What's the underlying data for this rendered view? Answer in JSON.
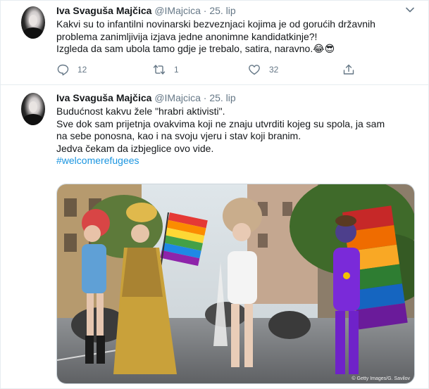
{
  "tweets": [
    {
      "name": "Iva Svaguša Majčica",
      "handle": "@IMajcica",
      "dot": "·",
      "date": "25. lip",
      "lines": [
        "Kakvi su to infantilni novinarski bezveznjaci kojima je od gorućih državnih",
        "problema zanimljivija izjava jedne anonimne kandidatkinje?!",
        "Izgleda da sam ubola tamo gdje je trebalo, satira, naravno.😂😎"
      ],
      "reply_count": "12",
      "retweet_count": "1",
      "like_count": "32"
    },
    {
      "name": "Iva Svaguša Majčica",
      "handle": "@IMajcica",
      "dot": "·",
      "date": "25. lip",
      "lines": [
        "Budućnost kakvu žele \"hrabri aktivisti\".",
        "Sve dok sam prijetnja ovakvima koji ne znaju utvrditi kojeg su spola, ja sam",
        "na sebe ponosna, kao i na svoju vjeru i stav koji branim.",
        "Jedva čekam da izbjeglice ovo vide."
      ],
      "hashtag": "#welcomerefugees",
      "image_credit": "© Getty Images/G. Savilov"
    }
  ],
  "icons": {
    "more": "chevron-down-icon",
    "reply": "reply-icon",
    "retweet": "retweet-icon",
    "like": "heart-icon",
    "share": "share-icon"
  },
  "colors": {
    "text": "#14171a",
    "secondary": "#657786",
    "link": "#1b95e0",
    "border": "#e6ecf0"
  }
}
